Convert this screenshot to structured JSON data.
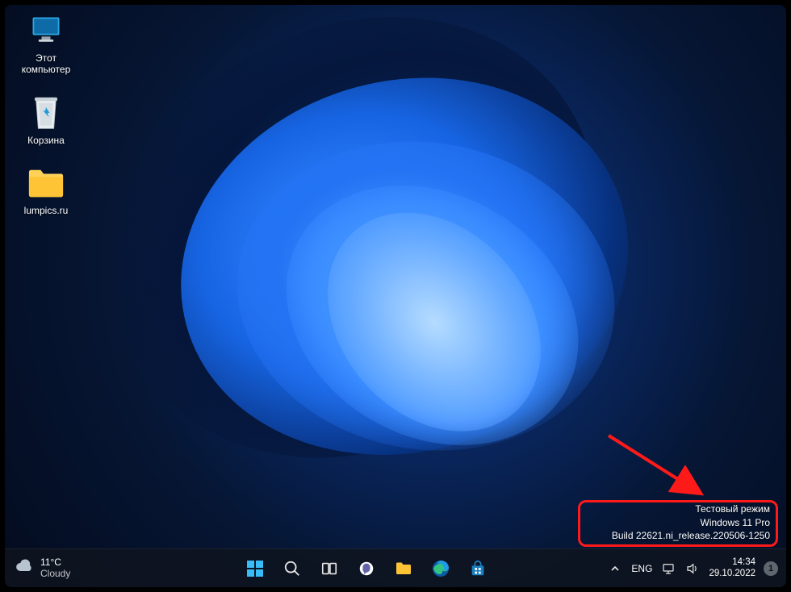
{
  "desktop": {
    "icons": [
      {
        "name": "this-pc",
        "label": "Этот\nкомпьютер"
      },
      {
        "name": "recycle-bin",
        "label": "Корзина"
      },
      {
        "name": "folder",
        "label": "lumpics.ru"
      }
    ]
  },
  "watermark": {
    "line1": "Тестовый режим",
    "line2": "Windows 11 Pro",
    "line3": "Build 22621.ni_release.220506-1250"
  },
  "taskbar": {
    "weather": {
      "temp": "11°C",
      "condition": "Cloudy"
    },
    "language": "ENG",
    "clock": {
      "time": "14:34",
      "date": "29.10.2022"
    },
    "notification_count": "1"
  }
}
